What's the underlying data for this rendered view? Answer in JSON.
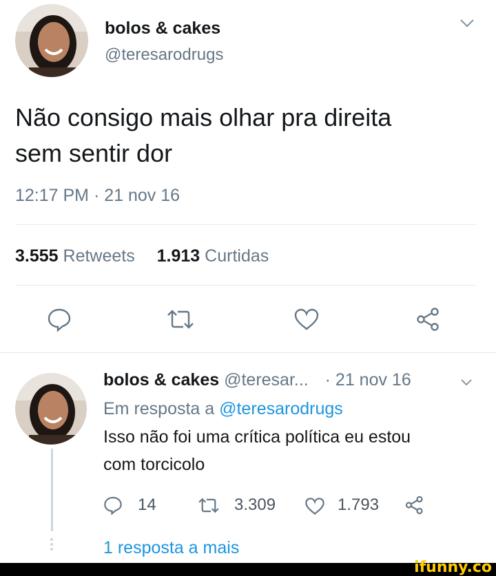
{
  "main_tweet": {
    "display_name": "bolos & cakes",
    "handle": "@teresarodrugs",
    "text_line1": "Não consigo mais olhar pra direita",
    "text_line2": "sem sentir dor",
    "timestamp": "12:17 PM · 21 nov 16",
    "retweets_count": "3.555",
    "retweets_label": "Retweets",
    "likes_count": "1.913",
    "likes_label": "Curtidas"
  },
  "reply_tweet": {
    "display_name": "bolos & cakes",
    "handle": "@teresar...",
    "date": "· 21 nov 16",
    "reply_prefix": "Em resposta a",
    "reply_to": "@teresarodrugs",
    "text_line1": "Isso não foi uma crítica política eu estou",
    "text_line2": "com torcicolo",
    "replies_count": "14",
    "retweets_count": "3.309",
    "likes_count": "1.793"
  },
  "more_replies": "1 resposta a mais",
  "watermark": "ifunny.co",
  "colors": {
    "accent": "#1b95e0",
    "muted": "#657786",
    "divider": "#e6ecf0",
    "footer": "#000000",
    "watermark": "#ffcc00"
  },
  "icons": [
    "reply-icon",
    "retweet-icon",
    "like-icon",
    "share-icon",
    "chevron-down-icon"
  ]
}
